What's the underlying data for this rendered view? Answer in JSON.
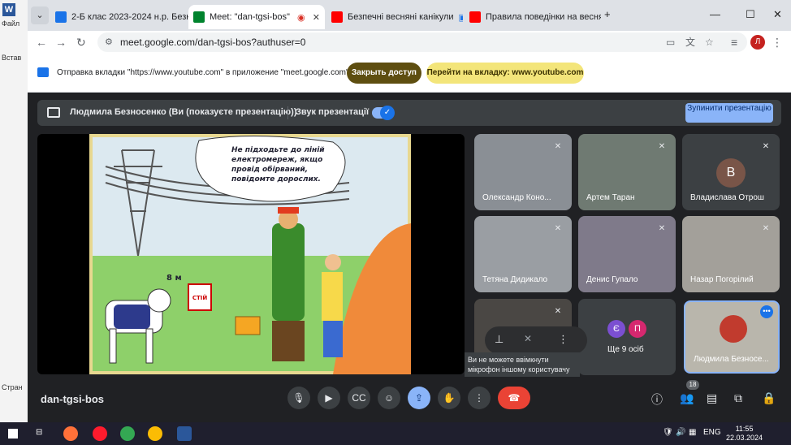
{
  "browser": {
    "tabs": [
      {
        "label": "2-Б клас 2023-2024 н.р. Безнос",
        "color": "#1a73e8"
      },
      {
        "label": "Meet: \"dan-tgsi-bos\"",
        "color": "#00832d"
      },
      {
        "label": "Безпечні весняні канікули",
        "color": "#ff0000"
      },
      {
        "label": "Правила поведінки на весня",
        "color": "#ff0000"
      }
    ],
    "url": "meet.google.com/dan-tgsi-bos?authuser=0",
    "profile_initial": "Л"
  },
  "infobar": {
    "message": "Отправка вкладки \"https://www.youtube.com\" в приложение \"meet.google.com\"...",
    "close_access": "Закрыть доступ",
    "switch_tab": "Перейти на вкладку: www.youtube.com"
  },
  "word": {
    "file_menu": "Файл",
    "paste": "Встав",
    "page": "Стран"
  },
  "meet": {
    "presenting_text": "Людмила Безносенко (Ви (показуєте презентацію))",
    "sound_label": "Звук презентації",
    "stop_label": "Зупинити презентацію",
    "slide_caption": "Не підходьте до ліній електромереж, якщо провід обірваний, повідомте дорослих.",
    "slide_distance": "8 м",
    "slide_sign": "СТІЙ",
    "participants": [
      {
        "name": "Олександр Коно..."
      },
      {
        "name": "Артем Таран"
      },
      {
        "name": "Владислава Отрош",
        "initial": "В"
      },
      {
        "name": "Тетяна Дидикало"
      },
      {
        "name": "Денис Гупало"
      },
      {
        "name": "Назар Погорілий"
      },
      {
        "name": ""
      },
      {
        "name": "Ще 9 осіб",
        "initials": [
          "Є",
          "П"
        ]
      },
      {
        "name": "Людмила Безносе..."
      }
    ],
    "tooltip": "Ви не можете ввімкнути мікрофон іншому користувачу",
    "meeting_code": "dan-tgsi-bos",
    "participants_count": "18"
  },
  "taskbar": {
    "lang": "ENG",
    "time": "11:55",
    "date": "22.03.2024"
  }
}
